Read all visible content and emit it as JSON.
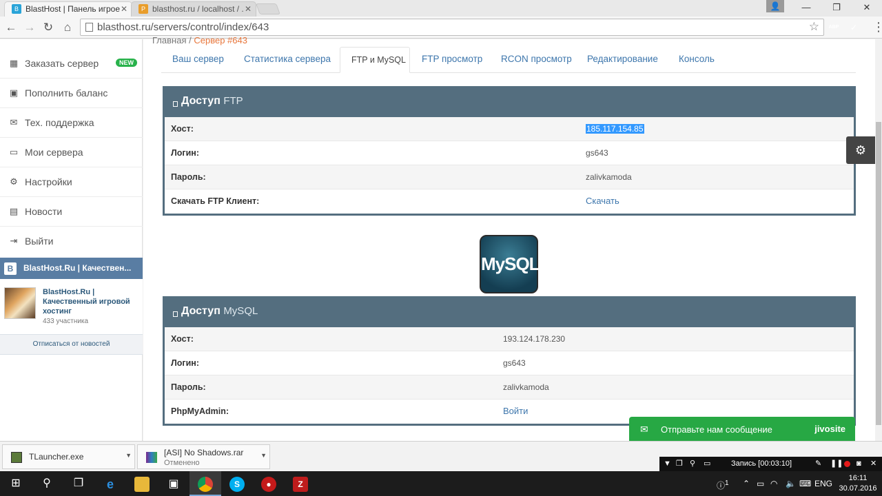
{
  "browser": {
    "tabs": [
      {
        "title": "BlastHost | Панель игрое",
        "active": true
      },
      {
        "title": "blasthost.ru / localhost / ."
      }
    ],
    "url": "blasthost.ru/servers/control/index/643",
    "extensions": [
      {
        "label": "ABP",
        "color": "#d31f26"
      },
      {
        "label": "✓",
        "color": "#3aa757"
      }
    ]
  },
  "sidebar": {
    "items": [
      {
        "label": "Заказать сервер",
        "icon": "grid-icon",
        "badge": "NEW"
      },
      {
        "label": "Пополнить баланс",
        "icon": "money-icon"
      },
      {
        "label": "Тех. поддержка",
        "icon": "envelope-icon"
      },
      {
        "label": "Мои сервера",
        "icon": "laptop-icon"
      },
      {
        "label": "Настройки",
        "icon": "gears-icon"
      },
      {
        "label": "Новости",
        "icon": "calendar-icon"
      },
      {
        "label": "Выйти",
        "icon": "sign-out-icon"
      }
    ],
    "vk_widget": {
      "header": "BlastHost.Ru | Качествен...",
      "group_name": "BlastHost.Ru | Качественный игровой хостинг",
      "members": "433 участника",
      "unsubscribe": "Отписаться от новостей"
    }
  },
  "breadcrumb": {
    "home": "Главная",
    "separator": "/",
    "current": "Сервер #643"
  },
  "tabs": [
    {
      "label": "Ваш сервер"
    },
    {
      "label": "Статистика сервера"
    },
    {
      "label": "FTP и MySQL",
      "active": true
    },
    {
      "label": "FTP просмотр"
    },
    {
      "label": "RCON просмотр"
    },
    {
      "label": "Редактирование"
    },
    {
      "label": "Консоль"
    }
  ],
  "ftp_panel": {
    "title_bold": "Доступ",
    "title_rest": "FTP",
    "rows": [
      {
        "key": "Хост:",
        "value": "185.117.154.85",
        "selected": true
      },
      {
        "key": "Логин:",
        "value": "gs643"
      },
      {
        "key": "Пароль:",
        "value": "zalivkamoda"
      },
      {
        "key": "Скачать FTP Клиент:",
        "value": "Скачать",
        "link": true
      }
    ]
  },
  "mysql_logo": "MySQL",
  "mysql_panel": {
    "title_bold": "Доступ",
    "title_rest": "MySQL",
    "rows": [
      {
        "key": "Хост:",
        "value": "193.124.178.230"
      },
      {
        "key": "Логин:",
        "value": "gs643"
      },
      {
        "key": "Пароль:",
        "value": "zalivkamoda"
      },
      {
        "key": "PhpMyAdmin:",
        "value": "Войти",
        "link": true
      }
    ]
  },
  "chat_widget": {
    "message": "Отправьте нам сообщение",
    "brand": "jivosite"
  },
  "downloads": [
    {
      "name": "TLauncher.exe",
      "status": ""
    },
    {
      "name": "[ASI] No Shadows.rar",
      "status": "Отменено"
    }
  ],
  "recorder": {
    "label": "Запись [00:03:10]"
  },
  "taskbar": {
    "lang": "ENG",
    "time": "16:11",
    "date": "30.07.2016",
    "notification_count": "1"
  },
  "colors": {
    "panel_header": "#546e7f",
    "link": "#3d76ac",
    "accent_orange": "#e8763b",
    "badge_green": "#28b24b",
    "vk_blue": "#597da3",
    "chat_green": "#27a844"
  }
}
